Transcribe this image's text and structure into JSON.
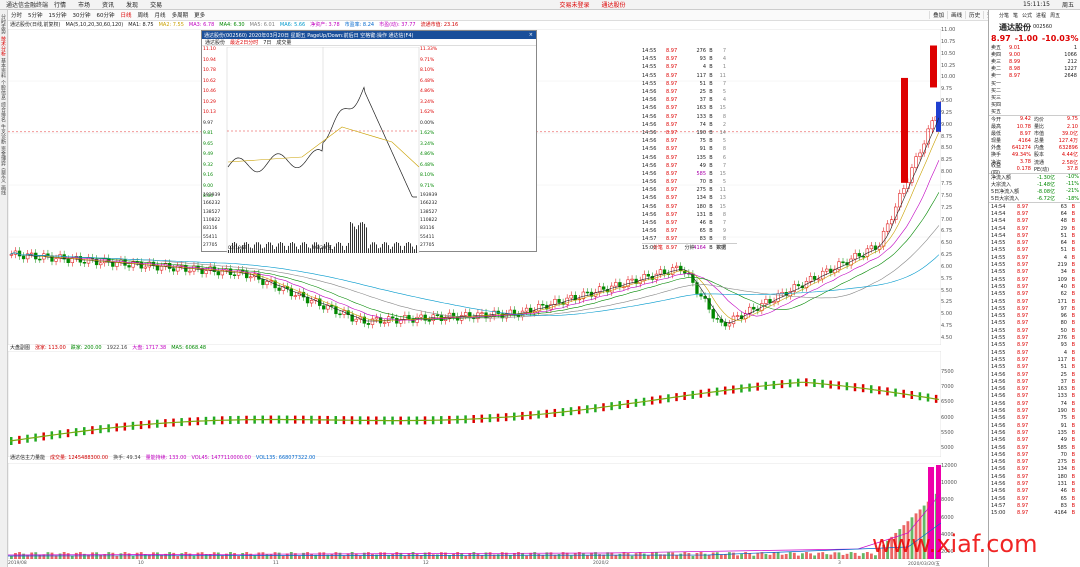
{
  "menubar": {
    "app_title": "通达信金融终端",
    "items": [
      "行情",
      "市场",
      "资讯",
      "发现",
      "交易"
    ],
    "alert_texts": [
      "交易未登录",
      "通达股份"
    ],
    "clock": "15:11:15",
    "window_btn": "周五"
  },
  "toolbar": {
    "periods": [
      "分时",
      "5分钟",
      "15分钟",
      "30分钟",
      "60分钟",
      "日线",
      "周线",
      "月线",
      "多周期",
      "更多"
    ],
    "active_period": "日线",
    "right_items": [
      "叠加",
      "画线",
      "历史",
      "预警",
      "F10",
      "标记",
      "+自选",
      "返回"
    ],
    "right_active": "F10"
  },
  "side_tabs": [
    "分时走势",
    "技术分析",
    "基本资料",
    "个股信息",
    "综合排名",
    "牛叉诊断",
    "资金博弈",
    "自定义",
    "画线"
  ],
  "side_active": "技术分析",
  "main_chart": {
    "stock_line": "通达股份(日线,前复权)",
    "ma_params": "MA(5,10,20,30,60,120)",
    "ma_values": [
      {
        "label": "MA1: 8.75",
        "color": "#222222"
      },
      {
        "label": "MA2: 7.55",
        "color": "#c9a000"
      },
      {
        "label": "MA3: 6.78",
        "color": "#c000c0"
      },
      {
        "label": "MA4: 6.30",
        "color": "#008800"
      },
      {
        "label": "MA5: 6.01",
        "color": "#808080"
      },
      {
        "label": "MA6: 5.66",
        "color": "#0099cc"
      }
    ],
    "extra_info": [
      {
        "label": "净资产: 3.78",
        "color": "#c000c0"
      },
      {
        "label": "市盈率: 8.24",
        "color": "#0066cc"
      },
      {
        "label": "市盈(动): 37.77",
        "color": "#c000c0"
      },
      {
        "label": "流通市值: 23.16",
        "color": "#d00000"
      }
    ],
    "price_labels": [
      "11.00",
      "10.75",
      "10.50",
      "10.25",
      "10.00",
      "9.75",
      "9.50",
      "9.25",
      "9.00",
      "8.75",
      "8.50",
      "8.25",
      "8.00",
      "7.75",
      "7.50",
      "7.25",
      "7.00",
      "6.75",
      "6.50",
      "6.25",
      "6.00",
      "5.75",
      "5.50",
      "5.25",
      "5.00",
      "4.75",
      "4.50"
    ],
    "current_price_tag": "8.97",
    "annotations": [
      "10.78",
      "4.85",
      "涨停",
      "跌停",
      "涨停",
      "涨停",
      "涨停"
    ]
  },
  "sub1": {
    "name": "大盘副图",
    "items": [
      {
        "label": "涨家: 113.00",
        "color": "#d00000"
      },
      {
        "label": "跌家: 200.00",
        "color": "#008800"
      },
      {
        "label": "1922.16",
        "color": "#444444"
      },
      {
        "label": "大盘: 1717.38",
        "color": "#c000c0"
      },
      {
        "label": "MA5: 6068.48",
        "color": "#008800"
      }
    ],
    "y_labels": [
      "7500",
      "7000",
      "6500",
      "6000",
      "5500",
      "5000"
    ]
  },
  "sub2": {
    "name": "通达信主力量能",
    "items": [
      {
        "label": "成交量: 1245488300.00",
        "color": "#d00000"
      },
      {
        "label": "换手: 49.34",
        "color": "#444444"
      },
      {
        "label": "量能持续: 133.00",
        "color": "#c000c0"
      },
      {
        "label": "VOL45: 1477110000.00",
        "color": "#c000c0"
      },
      {
        "label": "VOL135: 668077322.00",
        "color": "#0066cc"
      }
    ],
    "y_labels": [
      "12000",
      "10000",
      "8000",
      "6000",
      "4000",
      "2000"
    ]
  },
  "x_axis": [
    "2019/08",
    "10",
    "11",
    "12",
    "2020/2",
    "3",
    "2020/03/20/五"
  ],
  "popup": {
    "title": "通达股份(002560)  2020年03月20日 星期五  PageUp/Down:前后日  空格键:操作  通达信(F4)",
    "close": "×",
    "sub": [
      "通达股份",
      "最近2日分时",
      "7日",
      "成交量"
    ],
    "left_prices": [
      "11.10",
      "10.94",
      "10.78",
      "10.62",
      "10.46",
      "10.29",
      "10.13",
      "9.97",
      "9.81",
      "9.65",
      "9.49",
      "9.32",
      "9.16",
      "9.00",
      "8.84"
    ],
    "right_pcts": [
      "11.33%",
      "9.71%",
      "8.10%",
      "6.48%",
      "4.86%",
      "3.24%",
      "1.62%",
      "0.00%",
      "1.62%",
      "3.24%",
      "4.86%",
      "6.48%",
      "8.10%",
      "9.71%"
    ],
    "vol_labels": [
      "193939",
      "166232",
      "138527",
      "110822",
      "83116",
      "55411",
      "27705"
    ],
    "x_labels": [
      "03/19/四",
      "03/20/五"
    ],
    "ticks": [
      [
        "14:55",
        "8.97",
        "276",
        "B",
        "7"
      ],
      [
        "14:55",
        "8.97",
        "93",
        "B",
        "4"
      ],
      [
        "14:55",
        "8.97",
        "4",
        "B",
        "1"
      ],
      [
        "14:55",
        "8.97",
        "117",
        "B",
        "11"
      ],
      [
        "14:55",
        "8.97",
        "51",
        "B",
        "7"
      ],
      [
        "14:56",
        "8.97",
        "25",
        "B",
        "5"
      ],
      [
        "14:56",
        "8.97",
        "37",
        "B",
        "4"
      ],
      [
        "14:56",
        "8.97",
        "163",
        "B",
        "15"
      ],
      [
        "14:56",
        "8.97",
        "133",
        "B",
        "8"
      ],
      [
        "14:56",
        "8.97",
        "74",
        "B",
        "2"
      ],
      [
        "14:56",
        "8.97",
        "190",
        "B",
        "14"
      ],
      [
        "14:56",
        "8.97",
        "75",
        "B",
        "5"
      ],
      [
        "14:56",
        "8.97",
        "91",
        "B",
        "8"
      ],
      [
        "14:56",
        "8.97",
        "135",
        "B",
        "6"
      ],
      [
        "14:56",
        "8.97",
        "49",
        "B",
        "7"
      ],
      [
        "14:56",
        "8.97",
        "585",
        "B",
        "15"
      ],
      [
        "14:56",
        "8.97",
        "70",
        "B",
        "5"
      ],
      [
        "14:56",
        "8.97",
        "275",
        "B",
        "11"
      ],
      [
        "14:56",
        "8.97",
        "134",
        "B",
        "13"
      ],
      [
        "14:56",
        "8.97",
        "180",
        "B",
        "15"
      ],
      [
        "14:56",
        "8.97",
        "131",
        "B",
        "8"
      ],
      [
        "14:56",
        "8.97",
        "46",
        "B",
        "7"
      ],
      [
        "14:56",
        "8.97",
        "65",
        "B",
        "9"
      ],
      [
        "14:57",
        "8.97",
        "83",
        "B",
        "8"
      ],
      [
        "15:00",
        "8.97",
        "4164",
        "B",
        "478"
      ]
    ],
    "tabs": [
      "分笔",
      "分钟",
      "数据"
    ]
  },
  "panel": {
    "tabs": [
      "分笔",
      "笔",
      "公式",
      "进程",
      "周五"
    ],
    "name": "通达股份",
    "code": "002560",
    "price": "8.97",
    "change": "-1.00",
    "pct": "-10.03%",
    "book": [
      [
        "卖五",
        "9.01",
        "1"
      ],
      [
        "卖四",
        "9.00",
        "1066"
      ],
      [
        "卖三",
        "8.99",
        "212"
      ],
      [
        "卖二",
        "8.98",
        "1227"
      ],
      [
        "卖一",
        "8.97",
        "2648"
      ],
      [
        "买一",
        "",
        ""
      ],
      [
        "买二",
        "",
        ""
      ],
      [
        "买三",
        "",
        ""
      ],
      [
        "买四",
        "",
        ""
      ],
      [
        "买五",
        "",
        ""
      ]
    ],
    "stats": [
      [
        "今开",
        "9.42",
        "均价",
        "9.75"
      ],
      [
        "最高",
        "10.78",
        "量比",
        "2.10"
      ],
      [
        "最低",
        "8.97",
        "市值",
        "39.0亿"
      ],
      [
        "现量",
        "4164",
        "总量",
        "127.4万"
      ],
      [
        "外盘",
        "641274",
        "内盘",
        "632896"
      ],
      [
        "换手",
        "49.34%",
        "股本",
        "4.44亿"
      ],
      [
        "净资",
        "3.78",
        "流通",
        "2.58亿"
      ],
      [
        "收益(四)",
        "0.178",
        "PE(动)",
        "37.8"
      ]
    ],
    "flow": [
      [
        "净流入额",
        "-1.30亿",
        "-10%"
      ],
      [
        "大宗流入",
        "-1.48亿",
        "-11%"
      ],
      [
        "5日净流入额",
        "-8.08亿",
        "-21%"
      ],
      [
        "5日大宗流入",
        "-6.72亿",
        "-18%"
      ]
    ],
    "trades": [
      [
        "14:54",
        "8.97",
        "63",
        "B"
      ],
      [
        "14:54",
        "8.97",
        "64",
        "B"
      ],
      [
        "14:54",
        "8.97",
        "48",
        "B"
      ],
      [
        "14:54",
        "8.97",
        "29",
        "B"
      ],
      [
        "14:54",
        "8.97",
        "51",
        "B"
      ],
      [
        "14:55",
        "8.97",
        "64",
        "B"
      ],
      [
        "14:55",
        "8.97",
        "51",
        "B"
      ],
      [
        "14:55",
        "8.97",
        "4",
        "B"
      ],
      [
        "14:55",
        "8.97",
        "219",
        "B"
      ],
      [
        "14:55",
        "8.97",
        "34",
        "B"
      ],
      [
        "14:55",
        "8.97",
        "109",
        "B"
      ],
      [
        "14:55",
        "8.97",
        "40",
        "B"
      ],
      [
        "14:55",
        "8.97",
        "62",
        "B"
      ],
      [
        "14:55",
        "8.97",
        "171",
        "B"
      ],
      [
        "14:55",
        "8.97",
        "97",
        "B"
      ],
      [
        "14:55",
        "8.97",
        "96",
        "B"
      ],
      [
        "14:55",
        "8.97",
        "80",
        "B"
      ],
      [
        "14:55",
        "8.97",
        "50",
        "B"
      ],
      [
        "14:55",
        "8.97",
        "276",
        "B"
      ],
      [
        "14:55",
        "8.97",
        "93",
        "B"
      ],
      [
        "14:55",
        "8.97",
        "4",
        "B"
      ],
      [
        "14:55",
        "8.97",
        "117",
        "B"
      ],
      [
        "14:55",
        "8.97",
        "51",
        "B"
      ],
      [
        "14:56",
        "8.97",
        "25",
        "B"
      ],
      [
        "14:56",
        "8.97",
        "37",
        "B"
      ],
      [
        "14:56",
        "8.97",
        "163",
        "B"
      ],
      [
        "14:56",
        "8.97",
        "133",
        "B"
      ],
      [
        "14:56",
        "8.97",
        "74",
        "B"
      ],
      [
        "14:56",
        "8.97",
        "190",
        "B"
      ],
      [
        "14:56",
        "8.97",
        "75",
        "B"
      ],
      [
        "14:56",
        "8.97",
        "91",
        "B"
      ],
      [
        "14:56",
        "8.97",
        "135",
        "B"
      ],
      [
        "14:56",
        "8.97",
        "49",
        "B"
      ],
      [
        "14:56",
        "8.97",
        "585",
        "B"
      ],
      [
        "14:56",
        "8.97",
        "70",
        "B"
      ],
      [
        "14:56",
        "8.97",
        "275",
        "B"
      ],
      [
        "14:56",
        "8.97",
        "134",
        "B"
      ],
      [
        "14:56",
        "8.97",
        "180",
        "B"
      ],
      [
        "14:56",
        "8.97",
        "131",
        "B"
      ],
      [
        "14:56",
        "8.97",
        "46",
        "B"
      ],
      [
        "14:56",
        "8.97",
        "65",
        "B"
      ],
      [
        "14:57",
        "8.97",
        "83",
        "B"
      ],
      [
        "15:00",
        "8.97",
        "4164",
        "B"
      ]
    ]
  },
  "watermark": "www.xiaf.com"
}
